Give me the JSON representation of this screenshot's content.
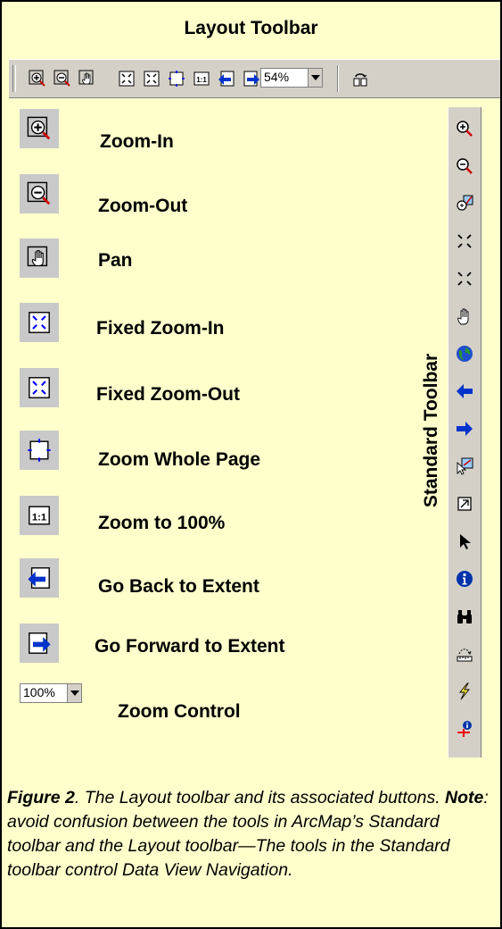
{
  "title": "Layout Toolbar",
  "layout_toolbar": {
    "zoom_value": "54%"
  },
  "rows": [
    {
      "label": "Zoom-In",
      "icon": "zoom-in-icon"
    },
    {
      "label": "Zoom-Out",
      "icon": "zoom-out-icon"
    },
    {
      "label": "Pan",
      "icon": "pan-hand-icon"
    },
    {
      "label": "Fixed Zoom-In",
      "icon": "fixed-zoom-in-icon"
    },
    {
      "label": "Fixed Zoom-Out",
      "icon": "fixed-zoom-out-icon"
    },
    {
      "label": "Zoom Whole Page",
      "icon": "zoom-whole-page-icon"
    },
    {
      "label": "Zoom to 100%",
      "icon": "zoom-100-icon"
    },
    {
      "label": "Go Back to Extent",
      "icon": "go-back-arrow-icon"
    },
    {
      "label": "Go Forward to Extent",
      "icon": "go-forward-arrow-icon"
    },
    {
      "label": "Zoom Control",
      "icon": "zoom-control-dropdown",
      "value": "100%"
    }
  ],
  "standard_toolbar": {
    "label": "Standard Toolbar",
    "icons": [
      "zoom-in-icon",
      "zoom-out-icon",
      "zoom-to-selection-icon",
      "fixed-zoom-in-icon",
      "fixed-zoom-out-icon",
      "pan-hand-icon",
      "globe-full-extent-icon",
      "back-arrow-icon",
      "forward-arrow-icon",
      "select-features-icon",
      "clear-selection-icon",
      "select-elements-arrow-icon",
      "identify-icon",
      "find-binoculars-icon",
      "measure-icon",
      "hyperlink-lightning-icon",
      "html-popup-icon"
    ]
  },
  "caption": {
    "fig": "Figure 2",
    "text1": ".  The Layout toolbar and its associated buttons. ",
    "note": "Note",
    "text2": ": avoid confusion between the tools in ArcMap’s Standard toolbar and the Layout tool­bar—The tools in the Standard toolbar control Data View Navigation."
  },
  "colors": {
    "background": "#ffffcc",
    "toolbar": "#d4d0c8",
    "arrow_blue": "#0033cc"
  }
}
